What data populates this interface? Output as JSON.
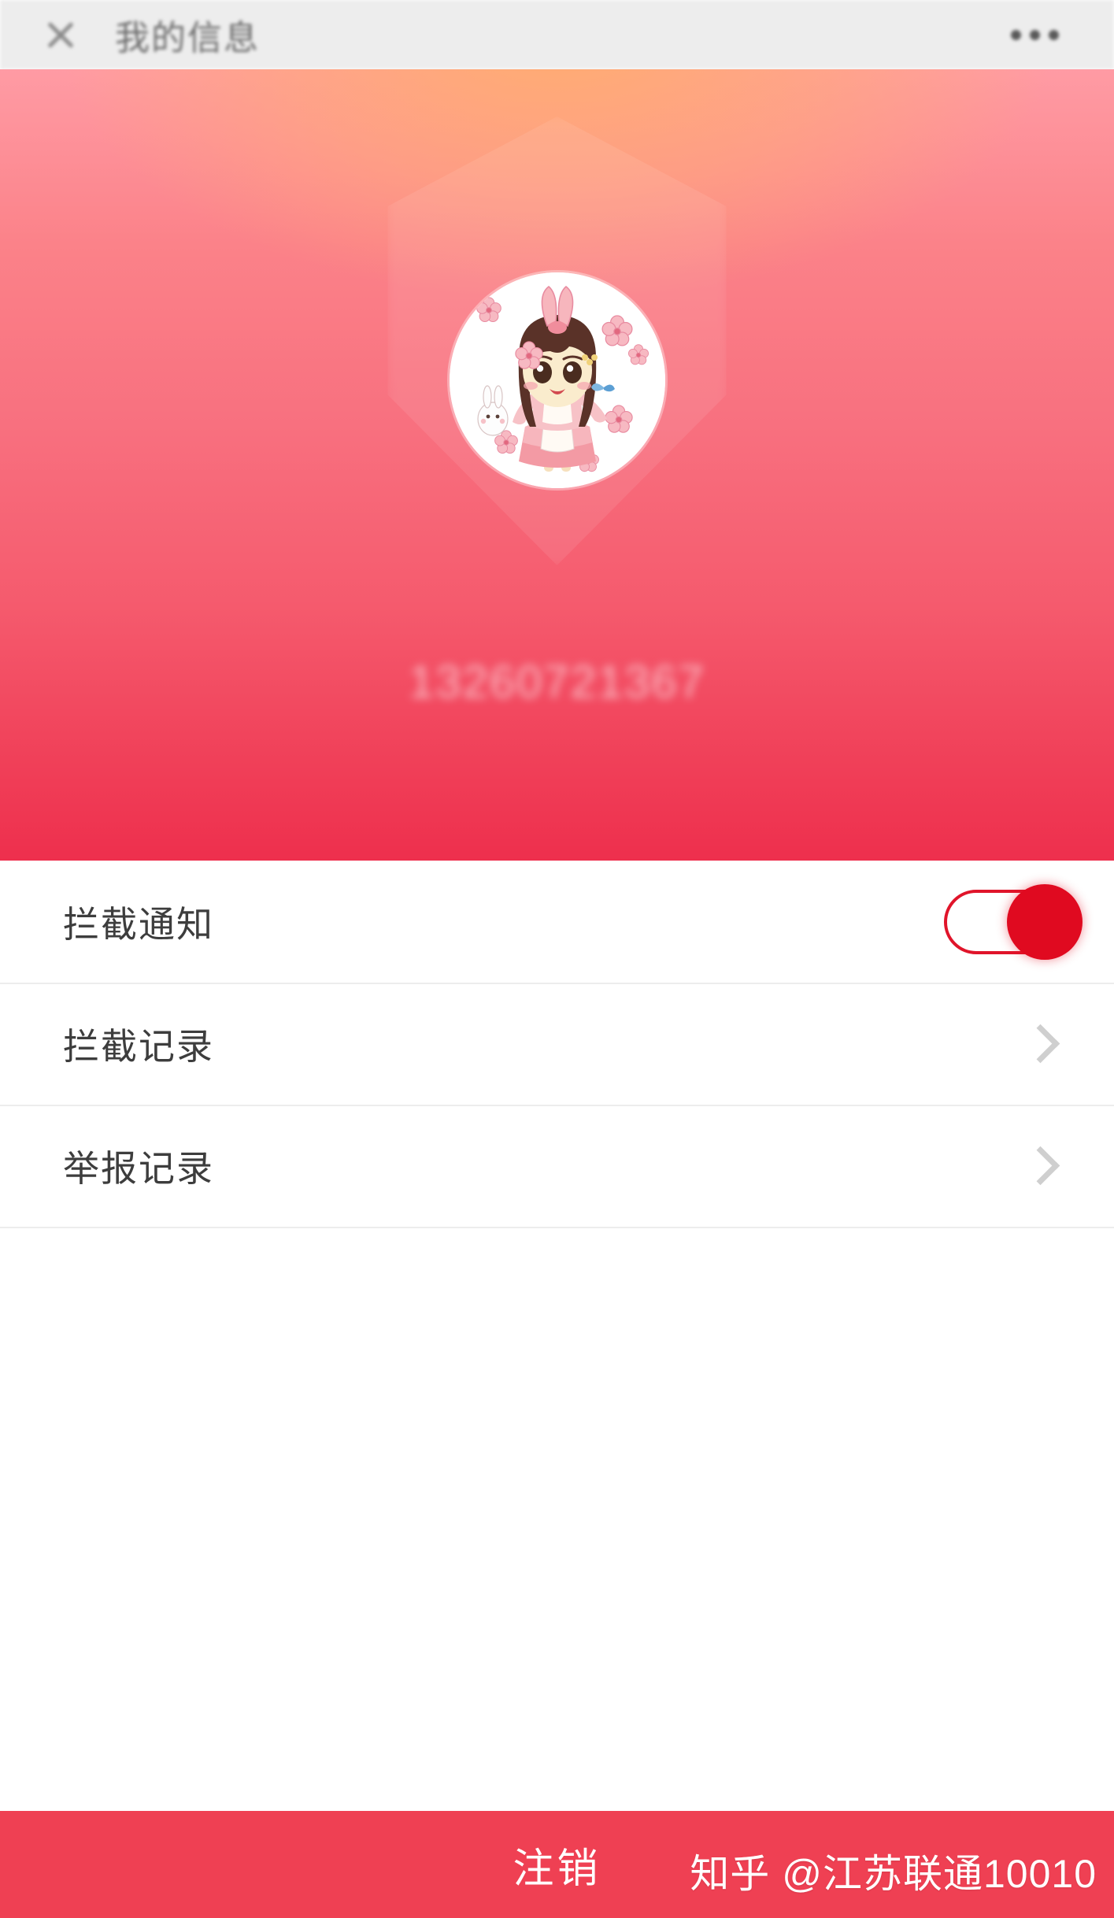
{
  "header": {
    "close_icon": "close-icon",
    "title": "我的信息",
    "more_icon": "more-options-icon"
  },
  "hero": {
    "avatar_alt": "cartoon-girl-avatar",
    "shield_watermark": "shield-icon",
    "phone_number": "13260721367",
    "gradient_top": "#ff9ba4",
    "gradient_bottom": "#ee2f4d",
    "gradient_accent": "#ffad6e"
  },
  "list": {
    "rows": [
      {
        "label": "拦截通知",
        "control": "toggle",
        "toggle_on": true,
        "toggle_color": "#e00a20"
      },
      {
        "label": "拦截记录",
        "control": "chevron"
      },
      {
        "label": "举报记录",
        "control": "chevron"
      }
    ]
  },
  "bottom": {
    "logout_label": "注销",
    "bar_color": "#ef4053"
  },
  "watermark": {
    "text": "知乎 @江苏联通10010"
  }
}
